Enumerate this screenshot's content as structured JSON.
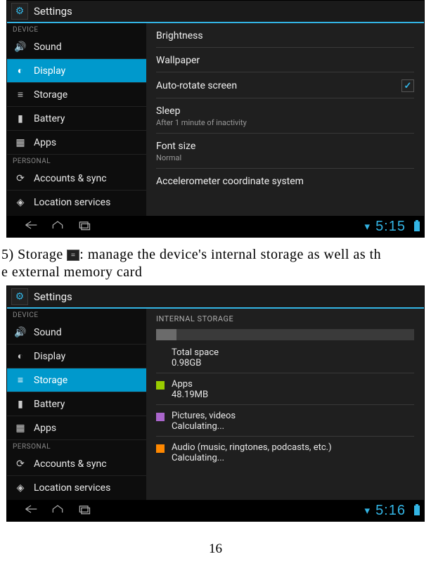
{
  "page_number": "16",
  "body_text_1a": "5)  Storage ",
  "body_text_1b": ":  manage  the  device's  internal  storage  as  well  as  th",
  "body_text_2": "e  external  memory  card",
  "shot1": {
    "title": "Settings",
    "cat_device": "DEVICE",
    "cat_personal": "PERSONAL",
    "sidebar": {
      "sound": "Sound",
      "display": "Display",
      "storage": "Storage",
      "battery": "Battery",
      "apps": "Apps",
      "accounts": "Accounts & sync",
      "location": "Location services"
    },
    "main": {
      "brightness": "Brightness",
      "wallpaper": "Wallpaper",
      "autorotate": "Auto-rotate screen",
      "sleep": "Sleep",
      "sleep_sub": "After 1 minute of inactivity",
      "fontsize": "Font size",
      "fontsize_sub": "Normal",
      "accel": "Accelerometer coordinate system"
    },
    "clock": "5:15"
  },
  "shot2": {
    "title": "Settings",
    "cat_device": "DEVICE",
    "cat_personal": "PERSONAL",
    "sidebar": {
      "sound": "Sound",
      "display": "Display",
      "storage": "Storage",
      "battery": "Battery",
      "apps": "Apps",
      "accounts": "Accounts & sync",
      "location": "Location services"
    },
    "main": {
      "section": "INTERNAL STORAGE",
      "total": "Total space",
      "total_val": "0.98GB",
      "apps": "Apps",
      "apps_val": "48.19MB",
      "apps_color": "#99cc00",
      "pics": "Pictures, videos",
      "pics_val": "Calculating...",
      "pics_color": "#aa66cc",
      "audio": "Audio (music, ringtones, podcasts, etc.)",
      "audio_val": "Calculating...",
      "audio_color": "#ff8800"
    },
    "clock": "5:16"
  }
}
